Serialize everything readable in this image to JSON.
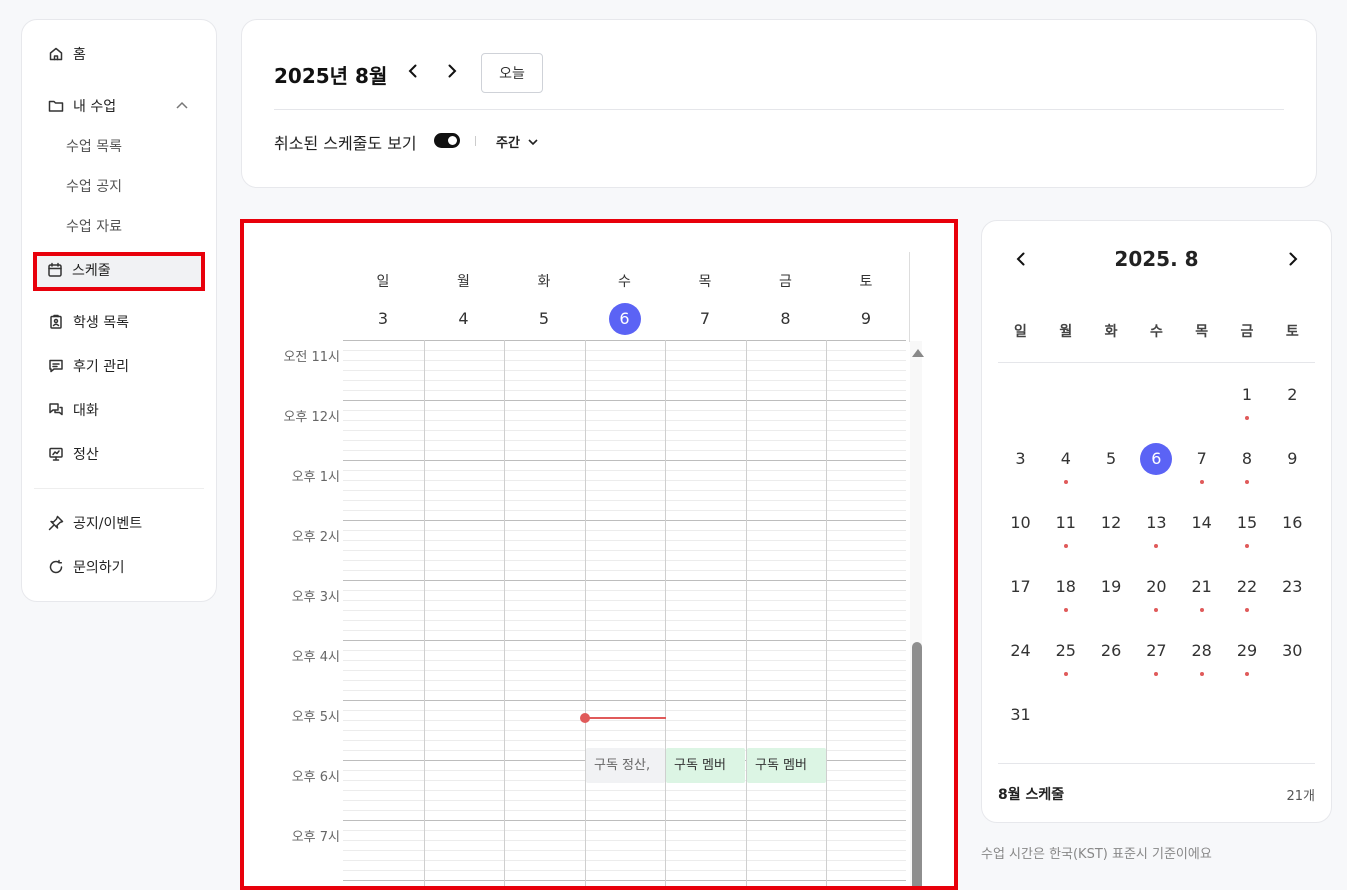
{
  "sidebar": {
    "home": "홈",
    "my_class": "내 수업",
    "sub_items": [
      "수업 목록",
      "수업 공지",
      "수업 자료"
    ],
    "schedule": "스케줄",
    "students": "학생 목록",
    "reviews": "후기 관리",
    "chat": "대화",
    "settlement": "정산",
    "notice": "공지/이벤트",
    "inquiry": "문의하기"
  },
  "header": {
    "month_title": "2025년 8월",
    "today_button": "오늘",
    "toggle_label": "취소된 스케줄도 보기",
    "toggle_on": true,
    "view_mode": "주간"
  },
  "week": {
    "days": [
      {
        "dow": "일",
        "num": "3"
      },
      {
        "dow": "월",
        "num": "4"
      },
      {
        "dow": "화",
        "num": "5"
      },
      {
        "dow": "수",
        "num": "6",
        "today": true
      },
      {
        "dow": "목",
        "num": "7"
      },
      {
        "dow": "금",
        "num": "8"
      },
      {
        "dow": "토",
        "num": "9"
      }
    ],
    "time_labels": [
      "오전 11시",
      "오후 12시",
      "오후 1시",
      "오후 2시",
      "오후 3시",
      "오후 4시",
      "오후 5시",
      "오후 6시",
      "오후 7시"
    ],
    "events": [
      {
        "title": "구독 정산,",
        "style": "gray"
      },
      {
        "title": "구독 멤버",
        "style": "green"
      },
      {
        "title": "구독 멤버",
        "style": "green"
      }
    ]
  },
  "mini_calendar": {
    "title": "2025. 8",
    "dows": [
      "일",
      "월",
      "화",
      "수",
      "목",
      "금",
      "토"
    ],
    "first_weekday": 5,
    "days_in_month": 31,
    "today": 6,
    "marked_days": [
      1,
      4,
      7,
      8,
      11,
      13,
      15,
      18,
      20,
      21,
      22,
      25,
      27,
      28,
      29
    ],
    "footer_label": "8월 스케줄",
    "footer_count": "21개"
  },
  "timezone_note": "수업 시간은 한국(KST) 표준시 기준이에요",
  "colors": {
    "accent": "#5b63f5",
    "highlight": "#e8000b",
    "now_line": "#e05a5a",
    "event_green": "#dcf5e4"
  }
}
